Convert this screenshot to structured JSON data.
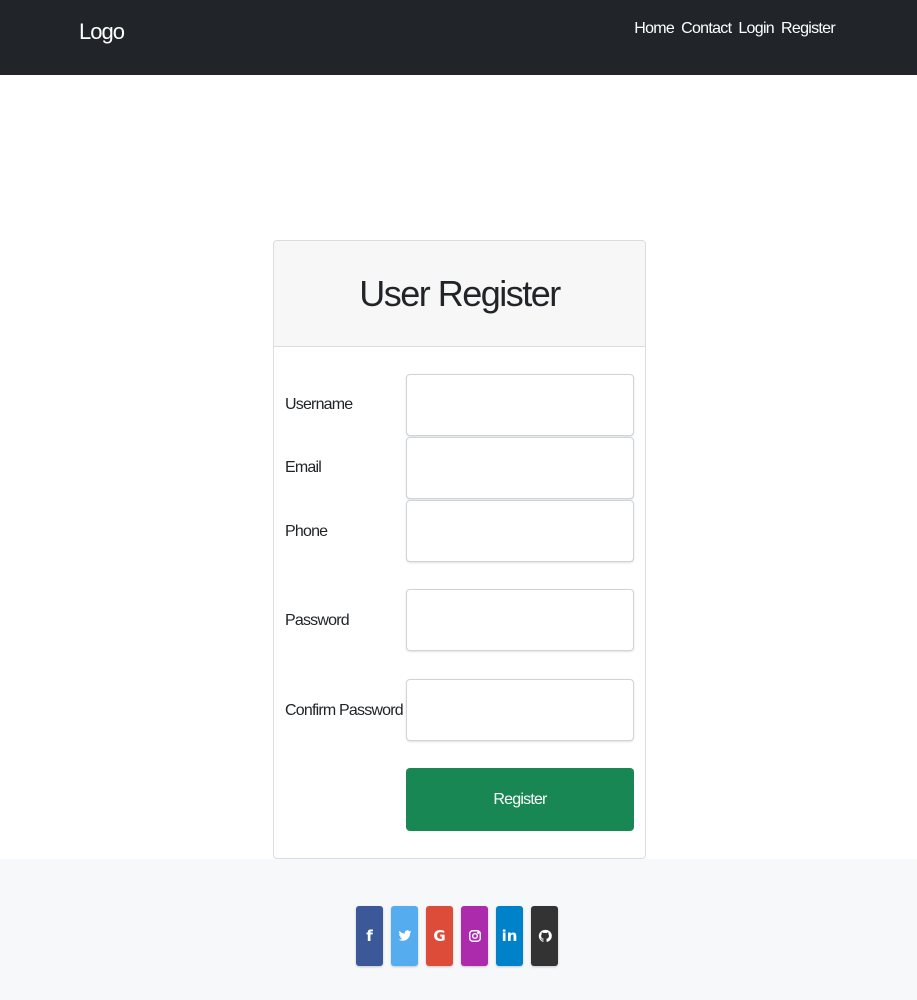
{
  "navbar": {
    "brand": "Logo",
    "links": [
      "Home",
      "Contact",
      "Login",
      "Register"
    ]
  },
  "card": {
    "title": "User Register",
    "fields": [
      {
        "label": "Username",
        "value": "",
        "type": "text"
      },
      {
        "label": "Email",
        "value": "",
        "type": "email"
      },
      {
        "label": "Phone",
        "value": "",
        "type": "tel"
      },
      {
        "label": "Password",
        "value": "",
        "type": "password"
      },
      {
        "label": "Confirm Password",
        "value": "",
        "type": "password"
      }
    ],
    "submit_label": "Register",
    "submit_color": "#198754"
  },
  "footer": {
    "social": [
      {
        "icon": "facebook-icon",
        "glyph": "f",
        "color": "#3b5998"
      },
      {
        "icon": "twitter-icon",
        "glyph": "",
        "color": "#55acee"
      },
      {
        "icon": "google-icon",
        "glyph": "G",
        "color": "#dd4b39"
      },
      {
        "icon": "instagram-icon",
        "glyph": "",
        "color": "#ac2bac"
      },
      {
        "icon": "linkedin-icon",
        "glyph": "in",
        "color": "#0082ca"
      },
      {
        "icon": "github-icon",
        "glyph": "",
        "color": "#333333"
      }
    ]
  }
}
